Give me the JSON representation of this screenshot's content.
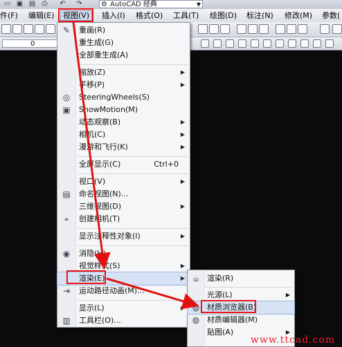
{
  "title_bar": {
    "workspace": "AutoCAD 经典"
  },
  "menubar": {
    "items": [
      "件(F)",
      "编辑(E)",
      "视图(V)",
      "插入(I)",
      "格式(O)",
      "工具(T)",
      "绘图(D)",
      "标注(N)",
      "修改(M)",
      "参数("
    ]
  },
  "layer_box": {
    "value": "0"
  },
  "view_menu": {
    "items": [
      {
        "label": "重画(R)",
        "icon": "pencil-icon"
      },
      {
        "label": "重生成(G)"
      },
      {
        "label": "全部重生成(A)"
      },
      {
        "label": "缩放(Z)",
        "submenu": true
      },
      {
        "label": "平移(P)",
        "submenu": true
      },
      {
        "label": "SteeringWheels(S)",
        "icon": "steering-wheel-icon"
      },
      {
        "label": "ShowMotion(M)",
        "icon": "showmotion-icon"
      },
      {
        "label": "动态观察(B)",
        "submenu": true
      },
      {
        "label": "相机(C)",
        "submenu": true
      },
      {
        "label": "漫游和飞行(K)",
        "submenu": true
      },
      {
        "label": "全屏显示(C)",
        "shortcut": "Ctrl+0"
      },
      {
        "label": "视口(V)",
        "submenu": true
      },
      {
        "label": "命名视图(N)...",
        "icon": "named-view-icon"
      },
      {
        "label": "三维视图(D)",
        "submenu": true
      },
      {
        "label": "创建相机(T)",
        "icon": "camera-icon"
      },
      {
        "label": "显示注释性对象(I)",
        "submenu": true
      },
      {
        "label": "消隐(H)",
        "icon": "hide-icon"
      },
      {
        "label": "视觉样式(S)",
        "submenu": true
      },
      {
        "label": "渲染(E)",
        "submenu": true
      },
      {
        "label": "运动路径动画(M)...",
        "icon": "motion-path-icon"
      },
      {
        "label": "显示(L)",
        "submenu": true
      },
      {
        "label": "工具栏(O)...",
        "icon": "toolbar-icon"
      }
    ]
  },
  "render_submenu": {
    "items": [
      {
        "label": "渲染(R)",
        "icon": "teapot-icon"
      },
      {
        "label": "光源(L)",
        "submenu": true
      },
      {
        "label": "材质浏览器(B)",
        "icon": "material-browser-icon"
      },
      {
        "label": "材质编辑器(M)",
        "icon": "material-editor-icon"
      },
      {
        "label": "贴图(A)",
        "submenu": true
      }
    ]
  },
  "watermark": "www.ttcad.com",
  "highlight_color": "#e11111"
}
